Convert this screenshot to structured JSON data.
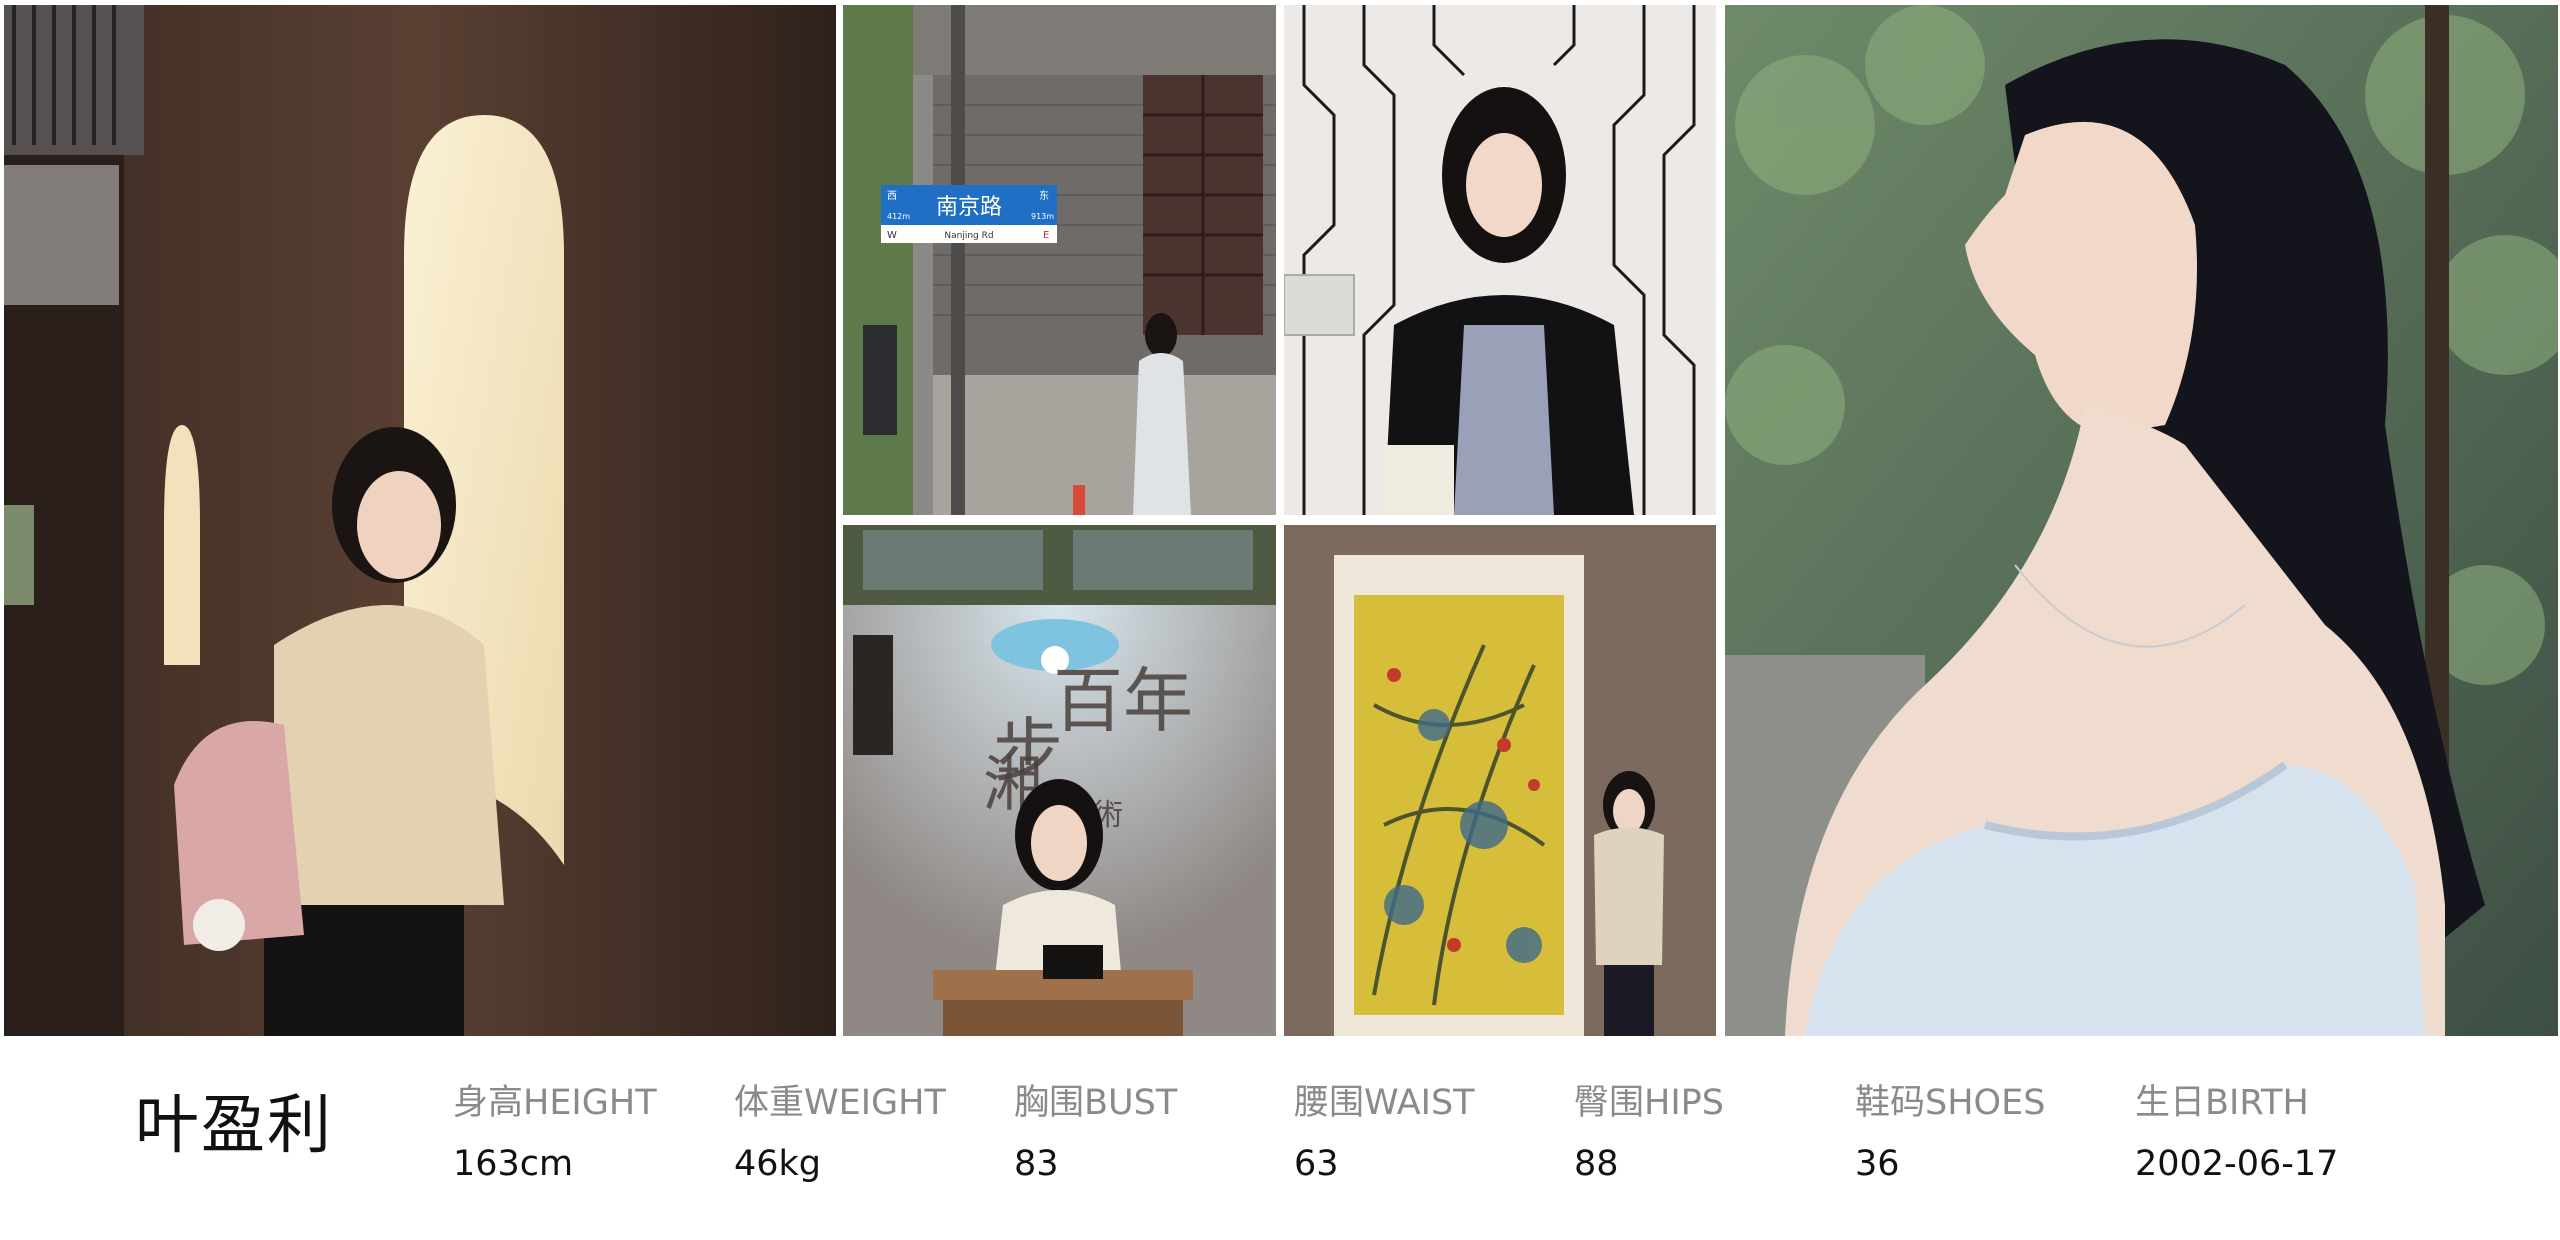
{
  "model": {
    "name": "叶盈利"
  },
  "stats": [
    {
      "label": "身高HEIGHT",
      "value": "163cm"
    },
    {
      "label": "体重WEIGHT",
      "value": "46kg"
    },
    {
      "label": "胸围BUST",
      "value": "83"
    },
    {
      "label": "腰围WAIST",
      "value": "63"
    },
    {
      "label": "臀围HIPS",
      "value": "88"
    },
    {
      "label": "鞋码SHOES",
      "value": "36"
    },
    {
      "label": "生日BIRTH",
      "value": "2002-06-17"
    }
  ],
  "photos": {
    "street_sign": {
      "chinese": "南京路",
      "west_char": "西",
      "east_char": "东",
      "west_dist": "412m",
      "east_dist": "913m",
      "pinyin": "Nanjing Rd",
      "w": "W",
      "e": "E"
    },
    "poster_text": {
      "line1": "百年",
      "line2": "湘",
      "line3": "美術",
      "side": "步"
    }
  },
  "colors": {
    "label": "#8a8a8a",
    "value": "#111111",
    "sign_blue": "#1f6fc5"
  }
}
